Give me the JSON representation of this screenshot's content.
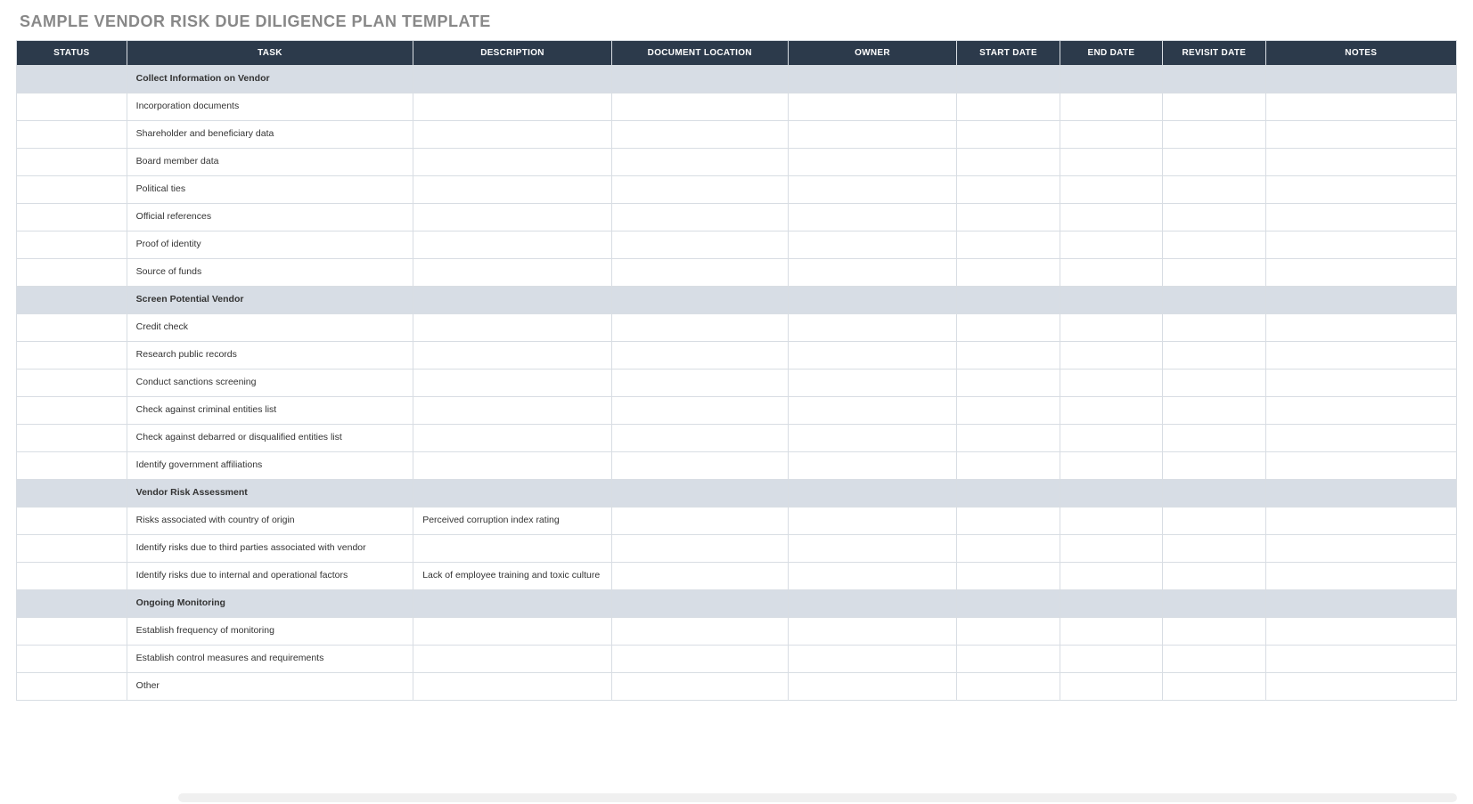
{
  "title": "SAMPLE VENDOR RISK DUE DILIGENCE PLAN TEMPLATE",
  "headers": {
    "status": "STATUS",
    "task": "TASK",
    "description": "DESCRIPTION",
    "doc_location": "DOCUMENT LOCATION",
    "owner": "OWNER",
    "start_date": "START DATE",
    "end_date": "END DATE",
    "revisit_date": "REVISIT DATE",
    "notes": "NOTES"
  },
  "rows": [
    {
      "type": "section",
      "task": "Collect Information on Vendor"
    },
    {
      "type": "item",
      "task": "Incorporation documents"
    },
    {
      "type": "item",
      "task": "Shareholder and beneficiary data"
    },
    {
      "type": "item",
      "task": "Board member data"
    },
    {
      "type": "item",
      "task": "Political ties"
    },
    {
      "type": "item",
      "task": "Official references"
    },
    {
      "type": "item",
      "task": "Proof of identity"
    },
    {
      "type": "item",
      "task": "Source of funds"
    },
    {
      "type": "section",
      "task": "Screen Potential Vendor"
    },
    {
      "type": "item",
      "task": "Credit check"
    },
    {
      "type": "item",
      "task": "Research public records"
    },
    {
      "type": "item",
      "task": "Conduct sanctions screening"
    },
    {
      "type": "item",
      "task": "Check against criminal entities list"
    },
    {
      "type": "item",
      "task": "Check against debarred or disqualified entities list"
    },
    {
      "type": "item",
      "task": "Identify government affiliations"
    },
    {
      "type": "section",
      "task": "Vendor Risk Assessment"
    },
    {
      "type": "item",
      "task": "Risks associated with country of origin",
      "description": "Perceived corruption index rating"
    },
    {
      "type": "item",
      "task": "Identify risks due to third parties associated with vendor"
    },
    {
      "type": "item",
      "task": "Identify risks due to internal and operational factors",
      "description": "Lack of employee training and toxic culture"
    },
    {
      "type": "section",
      "task": "Ongoing Monitoring"
    },
    {
      "type": "item",
      "task": "Establish frequency of monitoring"
    },
    {
      "type": "item",
      "task": "Establish control measures and requirements"
    },
    {
      "type": "item",
      "task": "Other"
    }
  ]
}
